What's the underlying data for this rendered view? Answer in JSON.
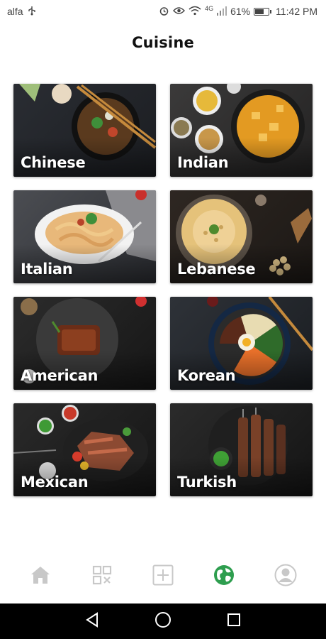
{
  "status_bar": {
    "carrier": "alfa",
    "network_type": "4G",
    "battery_percent": "61%",
    "battery_level": 0.61,
    "time": "11:42 PM",
    "icons": [
      "usb-icon",
      "alarm-icon",
      "eye-icon",
      "wifi-icon",
      "signal-icon",
      "battery-icon"
    ]
  },
  "header": {
    "title": "Cuisine"
  },
  "cuisines": [
    {
      "label": "Chinese",
      "colors": [
        "#2a2d33",
        "#1b1d21"
      ]
    },
    {
      "label": "Indian",
      "colors": [
        "#3b3a3a",
        "#232222"
      ]
    },
    {
      "label": "Italian",
      "colors": [
        "#4b4d52",
        "#2c2e33"
      ]
    },
    {
      "label": "Lebanese",
      "colors": [
        "#2e2722",
        "#1c1815"
      ]
    },
    {
      "label": "American",
      "colors": [
        "#2c2c2c",
        "#161616"
      ]
    },
    {
      "label": "Korean",
      "colors": [
        "#2e3238",
        "#1a1d21"
      ]
    },
    {
      "label": "Mexican",
      "colors": [
        "#2a2a2a",
        "#151515"
      ]
    },
    {
      "label": "Turkish",
      "colors": [
        "#2b2b2b",
        "#141414"
      ]
    }
  ],
  "bottom_nav": {
    "items": [
      "home-icon",
      "grid-icon",
      "add-icon",
      "globe-icon",
      "profile-icon"
    ],
    "active": "globe-icon",
    "active_color": "#2e9e4f",
    "inactive_color": "#c8c8c8"
  },
  "system_nav": [
    "back-icon",
    "home-circle-icon",
    "recents-icon"
  ]
}
